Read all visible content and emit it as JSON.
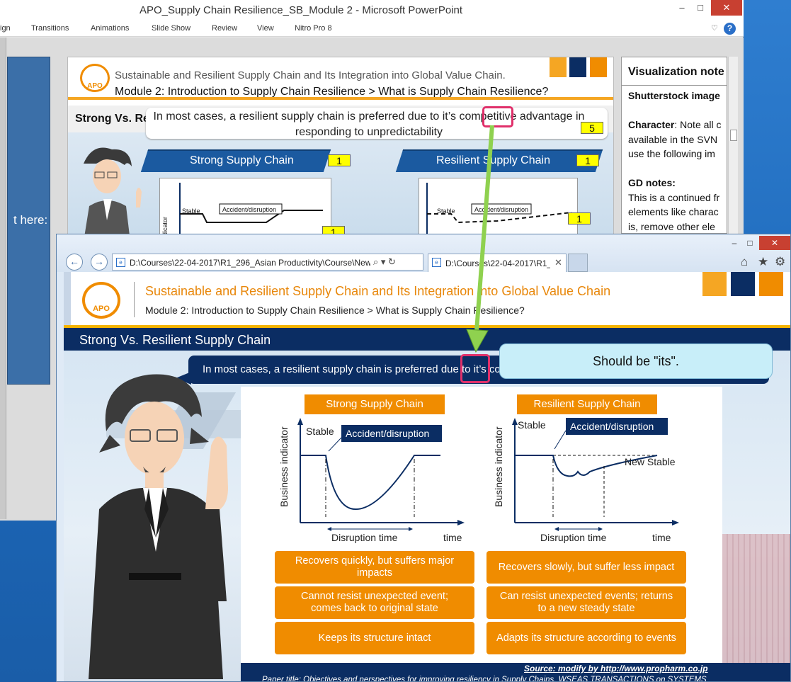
{
  "ppt": {
    "title": "APO_Supply Chain Resilience_SB_Module 2  -  Microsoft PowerPoint",
    "window_buttons": {
      "minimize": "–",
      "maximize": "□",
      "close": "✕"
    },
    "ribbon_tabs": [
      "ign",
      "Transitions",
      "Animations",
      "Slide Show",
      "Review",
      "View",
      "Nitro Pro 8"
    ],
    "help": "?",
    "collapse": "♡",
    "left_pane_text": "t here:",
    "slide": {
      "title_line1": "Sustainable and Resilient Supply Chain and Its Integration into Global Value Chain.",
      "title_line2": "Module 2: Introduction to Supply Chain Resilience > What is Supply Chain Resilience?",
      "section_title": "Strong Vs. Re",
      "callout": "In most cases, a resilient supply chain is preferred due to it’s competitive advantage in responding to unpredictability",
      "callout_badge": "5",
      "strong_header": "Strong Supply Chain",
      "resilient_header": "Resilient Supply Chain",
      "badges": [
        "1",
        "1",
        "1",
        "1"
      ],
      "chart_labels": {
        "stable": "Stable",
        "accident": "Accident/disruption",
        "y_axis": "indicator"
      },
      "logo": "APO"
    },
    "notes": {
      "heading": "Visualization note",
      "lines": [
        {
          "text": "Shutterstock image",
          "bold": true
        },
        {
          "text": "",
          "bold": false
        },
        {
          "text": "Character: Note all c",
          "bold": false
        },
        {
          "text": "available in the SVN",
          "bold": false
        },
        {
          "text": "use the following im",
          "bold": false
        },
        {
          "text": "",
          "bold": false
        },
        {
          "text": "GD notes:",
          "bold": true
        },
        {
          "text": "This is a continued fr",
          "bold": false
        },
        {
          "text": "elements like charac",
          "bold": false
        },
        {
          "text": "is, remove other ele",
          "bold": false
        }
      ]
    }
  },
  "ie": {
    "window_buttons": {
      "minimize": "–",
      "maximize": "□",
      "close": "✕"
    },
    "back": "←",
    "forward": "→",
    "address": "D:\\Courses\\22-04-2017\\R1_296_Asian Productivity\\Course\\New fold",
    "address_tools": "⌕ ▾ ↻",
    "tab_title": "D:\\Courses\\22-04-2017\\R1_...",
    "tab_close": "✕",
    "toolbar_icons": {
      "home": "⌂",
      "favorites": "★",
      "settings": "⚙"
    }
  },
  "slide": {
    "logo": "APO",
    "title_line1": "Sustainable and Resilient Supply Chain and Its Integration into Global Value Chain",
    "title_line2": "Module 2: Introduction to Supply Chain Resilience > What is Supply Chain Resilience?",
    "section_title": "Strong Vs. Resilient Supply Chain",
    "bubble_text": "In most cases, a resilient supply chain is preferred due to it’s con",
    "strong": {
      "header": "Strong Supply Chain",
      "stable": "Stable",
      "accident": "Accident/disruption",
      "y_axis": "Business indicator",
      "disruption_time": "Disruption time",
      "time": "time",
      "points": [
        "Recovers quickly, but suffers major impacts",
        "Cannot resist unexpected event; comes back to original state",
        "Keeps its structure intact"
      ]
    },
    "resilient": {
      "header": "Resilient Supply Chain",
      "stable": "Stable",
      "accident": "Accident/disruption",
      "new_stable": "New Stable",
      "y_axis": "Business indicator",
      "disruption_time": "Disruption time",
      "time": "time",
      "points": [
        "Recovers slowly, but suffer less impact",
        "Can resist unexpected events; returns to a new steady state",
        "Adapts its structure according to events"
      ]
    },
    "source": "Source: modify by http://www.propharm.co.jp",
    "paper": "Paper title: Objectives and perspectives for improving resiliency in Supply Chains, WSEAS TRANSACTIONS on SYSTEMS"
  },
  "annotation": {
    "comment": "Should be \"its\".",
    "colors": {
      "highlight": "#e0306a",
      "arrow": "#8fd14f",
      "comment_bg": "#c8eef9"
    }
  },
  "colors": {
    "navy": "#0b2d63",
    "orange": "#f08c00",
    "light_orange": "#f5a623",
    "gold_line": "#f5b400",
    "ppt_blue": "#1b5aa0"
  }
}
